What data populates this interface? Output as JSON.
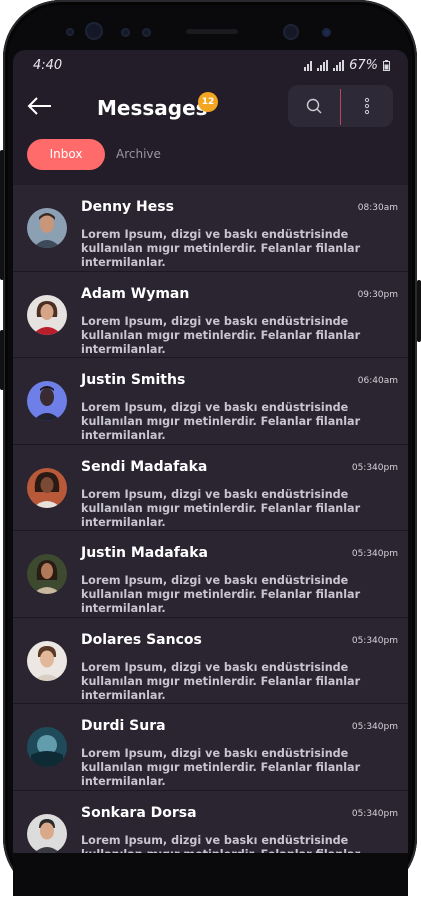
{
  "status_bar": {
    "time": "4:40",
    "battery": "67%"
  },
  "header": {
    "back_icon": "arrow-left-icon",
    "title": "Messages",
    "unread_count": "12",
    "search_icon": "search-icon",
    "more_icon": "more-vertical-icon"
  },
  "tabs": [
    {
      "label": "Inbox",
      "active": true
    },
    {
      "label": "Archive",
      "active": false
    }
  ],
  "messages": [
    {
      "name": "Denny Hess",
      "time": "08:30am",
      "text": "Lorem Ipsum, dizgi ve baskı endüstrisinde kullanılan mıgır metinlerdir. Felanlar filanlar intermilanlar."
    },
    {
      "name": "Adam Wyman",
      "time": "09:30pm",
      "text": "Lorem Ipsum, dizgi ve baskı endüstrisinde kullanılan mıgır metinlerdir. Felanlar filanlar intermilanlar."
    },
    {
      "name": "Justin Smiths",
      "time": "06:40am",
      "text": "Lorem Ipsum, dizgi ve baskı endüstrisinde kullanılan mıgır metinlerdir. Felanlar filanlar intermilanlar."
    },
    {
      "name": "Sendi Madafaka",
      "time": "05:340pm",
      "text": "Lorem Ipsum, dizgi ve baskı endüstrisinde kullanılan mıgır metinlerdir. Felanlar filanlar intermilanlar."
    },
    {
      "name": "Justin Madafaka",
      "time": "05:340pm",
      "text": "Lorem Ipsum, dizgi ve baskı endüstrisinde kullanılan mıgır metinlerdir. Felanlar filanlar intermilanlar."
    },
    {
      "name": "Dolares Sancos",
      "time": "05:340pm",
      "text": "Lorem Ipsum, dizgi ve baskı endüstrisinde kullanılan mıgır metinlerdir. Felanlar filanlar intermilanlar."
    },
    {
      "name": "Durdi Sura",
      "time": "05:340pm",
      "text": "Lorem Ipsum, dizgi ve baskı endüstrisinde kullanılan mıgır metinlerdir. Felanlar filanlar intermilanlar."
    },
    {
      "name": "Sonkara Dorsa",
      "time": "05:340pm",
      "text": "Lorem Ipsum, dizgi ve baskı endüstrisinde kullanılan mıgır metinlerdir. Felanlar filanlar intermilanlar."
    }
  ],
  "colors": {
    "screen_bg": "#221d29",
    "row_bg": "#2a2531",
    "accent": "#ff6b6b",
    "badge": "#f2a622"
  }
}
